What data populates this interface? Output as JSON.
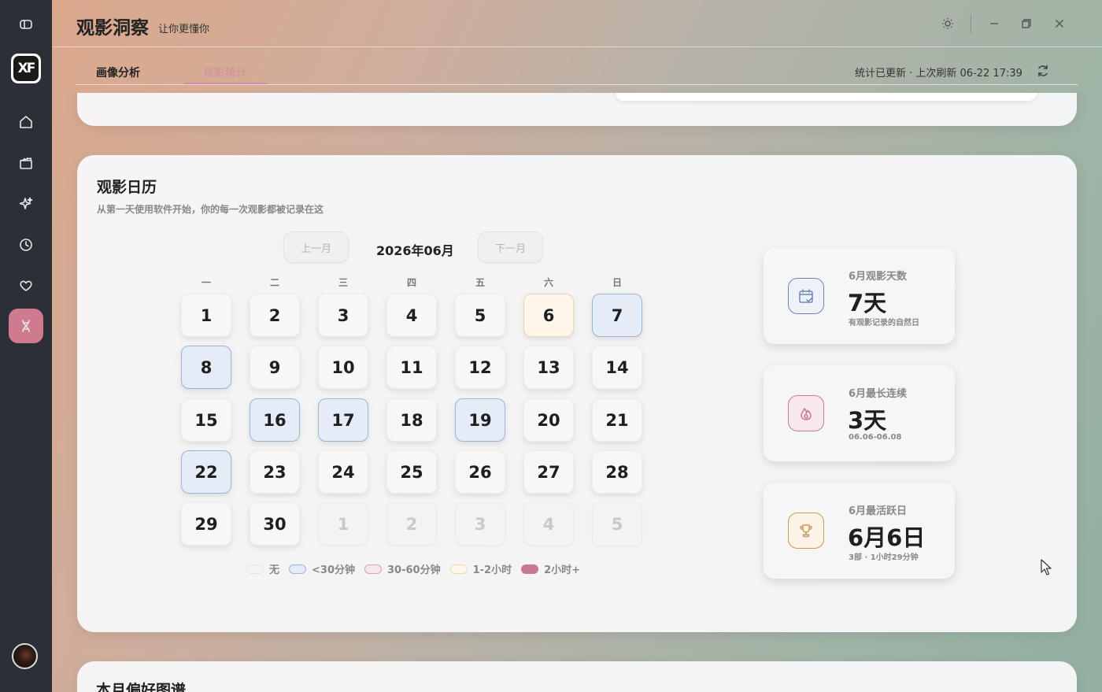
{
  "app": {
    "title": "观影洞察",
    "subtitle": "让你更懂你"
  },
  "tabs": [
    {
      "label": "画像分析",
      "active": false
    },
    {
      "label": "观影统计",
      "active": true
    }
  ],
  "refresh_status": "统计已更新 · 上次刷新 06-22 17:39",
  "sidebar": {
    "logo_text": "XF",
    "items": [
      {
        "icon": "home-icon"
      },
      {
        "icon": "film-icon"
      },
      {
        "icon": "sparkle-icon"
      },
      {
        "icon": "clock-icon"
      },
      {
        "icon": "heart-icon"
      },
      {
        "icon": "dna-icon",
        "active": true
      }
    ]
  },
  "calendar": {
    "title": "观影日历",
    "subtitle": "从第一天使用软件开始，你的每一次观影都被记录在这",
    "prev_label": "上一月",
    "next_label": "下一月",
    "month_label": "2026年06月",
    "weekdays": [
      "一",
      "二",
      "三",
      "四",
      "五",
      "六",
      "日"
    ],
    "days": [
      {
        "d": "1",
        "lv": 0
      },
      {
        "d": "2",
        "lv": 0
      },
      {
        "d": "3",
        "lv": 0
      },
      {
        "d": "4",
        "lv": 0
      },
      {
        "d": "5",
        "lv": 0
      },
      {
        "d": "6",
        "lv": 3
      },
      {
        "d": "7",
        "lv": 1
      },
      {
        "d": "8",
        "lv": 1
      },
      {
        "d": "9",
        "lv": 0
      },
      {
        "d": "10",
        "lv": 0
      },
      {
        "d": "11",
        "lv": 0
      },
      {
        "d": "12",
        "lv": 0
      },
      {
        "d": "13",
        "lv": 0
      },
      {
        "d": "14",
        "lv": 0
      },
      {
        "d": "15",
        "lv": 0
      },
      {
        "d": "16",
        "lv": 1
      },
      {
        "d": "17",
        "lv": 1
      },
      {
        "d": "18",
        "lv": 0
      },
      {
        "d": "19",
        "lv": 1
      },
      {
        "d": "20",
        "lv": 0
      },
      {
        "d": "21",
        "lv": 0
      },
      {
        "d": "22",
        "lv": 1
      },
      {
        "d": "23",
        "lv": 0
      },
      {
        "d": "24",
        "lv": 0
      },
      {
        "d": "25",
        "lv": 0
      },
      {
        "d": "26",
        "lv": 0
      },
      {
        "d": "27",
        "lv": 0
      },
      {
        "d": "28",
        "lv": 0
      },
      {
        "d": "29",
        "lv": 0
      },
      {
        "d": "30",
        "lv": 0
      },
      {
        "d": "1",
        "other": true
      },
      {
        "d": "2",
        "other": true
      },
      {
        "d": "3",
        "other": true
      },
      {
        "d": "4",
        "other": true
      },
      {
        "d": "5",
        "other": true
      }
    ],
    "legend": [
      {
        "label": "无",
        "fill": "#f3f3f5",
        "border": "#e4e4e6"
      },
      {
        "label": "<30分钟",
        "fill": "#e3ecf7",
        "border": "#9cb4d6"
      },
      {
        "label": "30-60分钟",
        "fill": "#f7e6ec",
        "border": "#d8a0b2"
      },
      {
        "label": "1-2小时",
        "fill": "#fdf6ea",
        "border": "#f0d6a8"
      },
      {
        "label": "2小时+",
        "fill": "#c8788f",
        "border": "#c8788f"
      }
    ]
  },
  "stats": [
    {
      "label": "6月观影天数",
      "value": "7天",
      "note": "有观影记录的自然日",
      "icon": "calendar-icon",
      "color": "#6f86b5",
      "bg": "#eef2f8"
    },
    {
      "label": "6月最长连续",
      "value": "3天",
      "note": "06.06-06.08",
      "icon": "flame-icon",
      "color": "#c8788f",
      "bg": "#f8e9ee"
    },
    {
      "label": "6月最活跃日",
      "value": "6月6日",
      "note": "3部 · 1小时29分钟",
      "icon": "trophy-icon",
      "color": "#c99a5a",
      "bg": "#fbf3e6"
    }
  ],
  "bottom_card": {
    "title": "本月偏好图谱"
  }
}
